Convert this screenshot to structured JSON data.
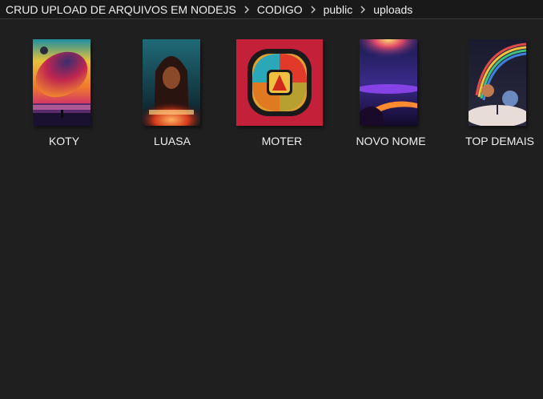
{
  "breadcrumb": {
    "items": [
      {
        "label": "CRUD UPLOAD DE ARQUIVOS EM NODEJS"
      },
      {
        "label": "CODIGO"
      },
      {
        "label": "public"
      },
      {
        "label": "uploads"
      }
    ],
    "separator_icon": "chevron-right-icon"
  },
  "files": [
    {
      "name": "KOTY"
    },
    {
      "name": "LUASA"
    },
    {
      "name": "MOTER"
    },
    {
      "name": "NOVO NOME"
    },
    {
      "name": "TOP DEMAIS"
    }
  ]
}
